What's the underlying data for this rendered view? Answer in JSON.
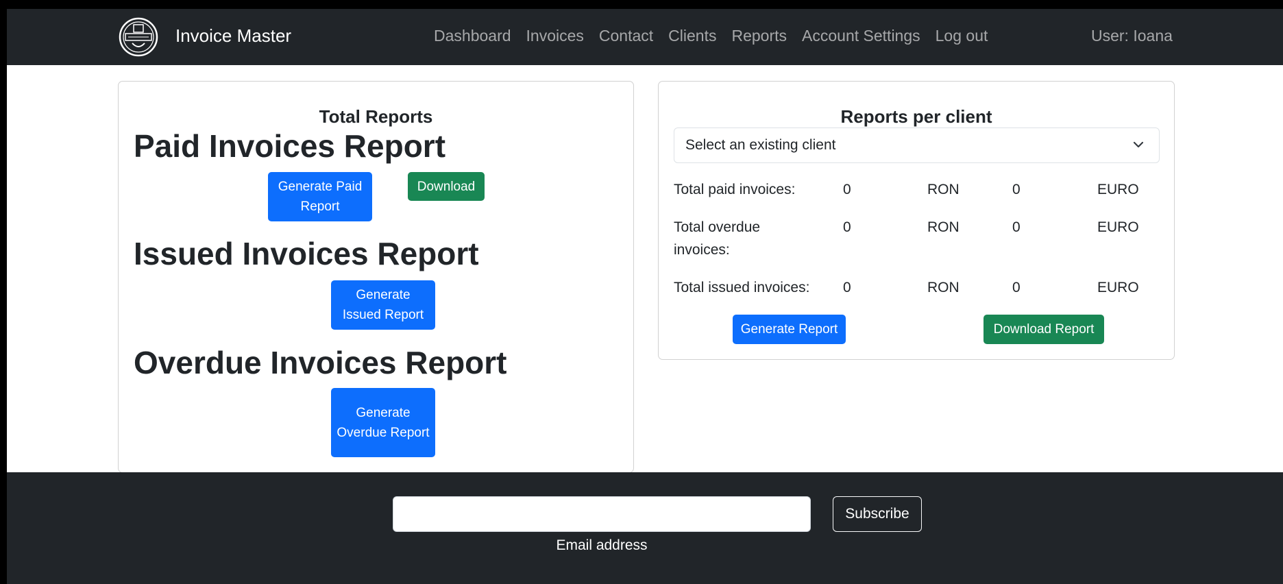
{
  "navbar": {
    "brand": "Invoice Master",
    "logo_icon": "invoice-master-logo",
    "links": [
      "Dashboard",
      "Invoices",
      "Contact",
      "Clients",
      "Reports",
      "Account Settings",
      "Log out"
    ],
    "user": "User: Ioana"
  },
  "total_reports": {
    "title": "Total Reports",
    "paid": {
      "heading": "Paid Invoices Report",
      "generate_label": "Generate Paid Report",
      "download_label": "Download"
    },
    "issued": {
      "heading": "Issued Invoices Report",
      "generate_label": "Generate Issued Report"
    },
    "overdue": {
      "heading": "Overdue Invoices Report",
      "generate_label": "Generate Overdue Report"
    }
  },
  "client_reports": {
    "title": "Reports per client",
    "select_value": "Select an existing client",
    "rows": [
      {
        "label": "Total paid invoices:",
        "ron": "0",
        "ron_unit": "RON",
        "euro": "0",
        "euro_unit": "EURO"
      },
      {
        "label": "Total overdue invoices:",
        "ron": "0",
        "ron_unit": "RON",
        "euro": "0",
        "euro_unit": "EURO"
      },
      {
        "label": "Total issued invoices:",
        "ron": "0",
        "ron_unit": "RON",
        "euro": "0",
        "euro_unit": "EURO"
      }
    ],
    "generate_label": "Generate Report",
    "download_label": "Download Report"
  },
  "footer": {
    "email_value": "",
    "email_label": "Email address",
    "subscribe_label": "Subscribe"
  },
  "colors": {
    "navbar": "#212529",
    "primary": "#0d6efd",
    "success": "#198754"
  }
}
